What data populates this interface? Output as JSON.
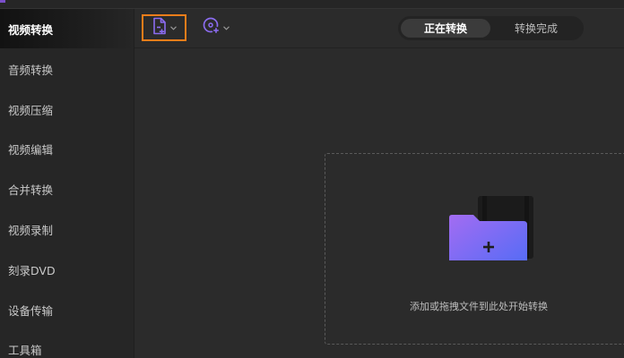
{
  "sidebar": {
    "items": [
      {
        "label": "视频转换",
        "active": true
      },
      {
        "label": "音频转换",
        "active": false
      },
      {
        "label": "视频压缩",
        "active": false
      },
      {
        "label": "视频编辑",
        "active": false
      },
      {
        "label": "合并转换",
        "active": false
      },
      {
        "label": "视频录制",
        "active": false
      },
      {
        "label": "刻录DVD",
        "active": false
      },
      {
        "label": "设备传输",
        "active": false
      },
      {
        "label": "工具箱",
        "active": false
      }
    ]
  },
  "toolbar": {
    "add_file_icon": "add-file-icon",
    "add_disc_icon": "add-disc-icon",
    "tabs": [
      {
        "label": "正在转换",
        "active": true
      },
      {
        "label": "转换完成",
        "active": false
      }
    ]
  },
  "main": {
    "drop_text": "添加或拖拽文件到此处开始转换",
    "folder_icon": "add-folder-icon"
  },
  "colors": {
    "accent_purple": "#8b6cf0",
    "highlight_orange": "#f07d1a",
    "folder_gradient_start": "#a36cf2",
    "folder_gradient_end": "#4f6cf6"
  }
}
